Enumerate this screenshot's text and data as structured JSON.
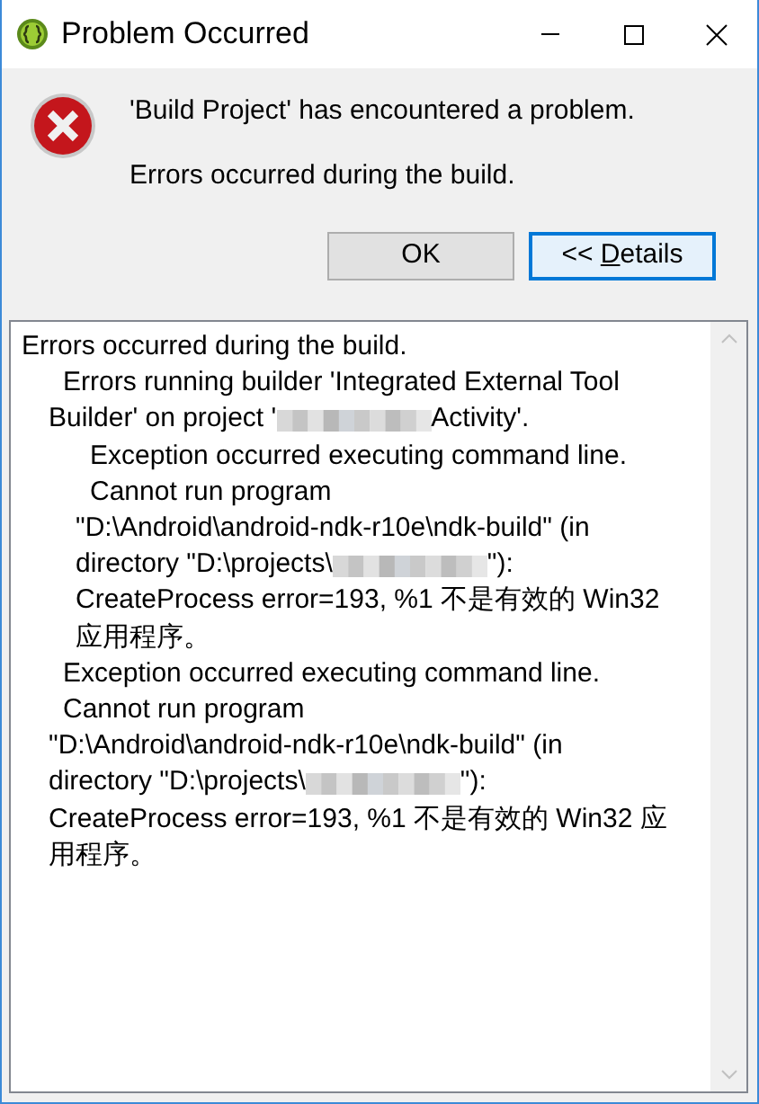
{
  "window": {
    "title": "Problem Occurred",
    "controls": [
      {
        "kind": "minimize"
      },
      {
        "kind": "maximize"
      },
      {
        "kind": "close"
      }
    ]
  },
  "message": {
    "title": "'Build Project' has encountered a problem.",
    "text": "Errors occurred during the build."
  },
  "buttons": [
    {
      "label": "OK",
      "focused": false,
      "access_key": false
    },
    {
      "label": "<< Details",
      "focused": true,
      "access_key": true
    }
  ],
  "details": [
    {
      "lines": [
        "Errors occurred during the build."
      ],
      "children": [
        {
          "lines": [
            "Errors running builder 'Integrated External Tool",
            {
              "segments": [
                {
                  "kind": "text",
                  "text": "Builder' on project '"
                },
                {
                  "kind": "redaction"
                },
                {
                  "kind": "text",
                  "text": "Activity'."
                }
              ]
            }
          ],
          "children": [
            {
              "lines": [
                "Exception occurred executing command line."
              ]
            },
            {
              "lines": [
                "Cannot run program",
                "\"D:\\Android\\android-ndk-r10e\\ndk-build\" (in",
                {
                  "segments": [
                    {
                      "kind": "text",
                      "text": "directory \"D:\\projects\\"
                    },
                    {
                      "kind": "redaction"
                    },
                    {
                      "kind": "text",
                      "text": "\"):"
                    }
                  ]
                },
                "CreateProcess error=193, %1 不是有效的 Win32",
                "应用程序。"
              ]
            }
          ]
        },
        {
          "lines": [
            "Exception occurred executing command line."
          ]
        },
        {
          "lines": [
            "Cannot run program",
            "\"D:\\Android\\android-ndk-r10e\\ndk-build\" (in",
            {
              "segments": [
                {
                  "kind": "text",
                  "text": "directory \"D:\\projects\\"
                },
                {
                  "kind": "redaction"
                },
                {
                  "kind": "text",
                  "text": "\"):"
                }
              ]
            },
            "CreateProcess error=193, %1 不是有效的 Win32 应",
            "用程序。"
          ]
        }
      ]
    }
  ]
}
